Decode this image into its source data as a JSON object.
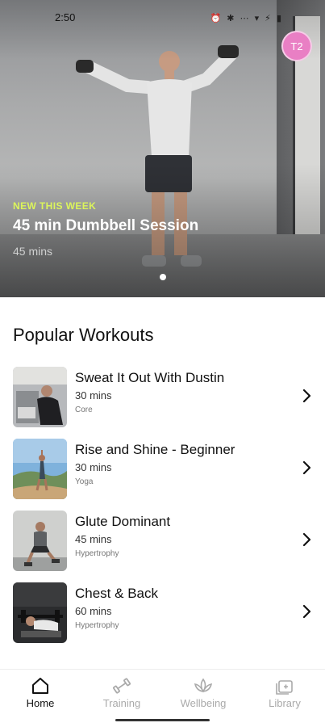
{
  "status_bar": {
    "time": "2:50",
    "icons": "⏰ ✱ ⋯ ▾ ⚡ ▮"
  },
  "profile": {
    "initials": "T2",
    "color": "#e97fc4"
  },
  "hero": {
    "tag": "NEW THIS WEEK",
    "title": "45 min Dumbbell Session",
    "subtitle": "45 mins",
    "tag_color": "#dcf55b",
    "carousel": {
      "count": 1,
      "active": 0
    }
  },
  "popular": {
    "title": "Popular Workouts",
    "items": [
      {
        "name": "Sweat It Out With Dustin",
        "duration": "30 mins",
        "category": "Core",
        "thumb": "gym-thumb"
      },
      {
        "name": "Rise and Shine - Beginner",
        "duration": "30 mins",
        "category": "Yoga",
        "thumb": "yoga-thumb"
      },
      {
        "name": "Glute Dominant",
        "duration": "45 mins",
        "category": "Hypertrophy",
        "thumb": "glute-thumb"
      },
      {
        "name": "Chest & Back",
        "duration": "60 mins",
        "category": "Hypertrophy",
        "thumb": "chest-thumb"
      }
    ]
  },
  "nav": {
    "items": [
      {
        "label": "Home",
        "icon": "home-icon",
        "active": true
      },
      {
        "label": "Training",
        "icon": "dumbbell-icon",
        "active": false
      },
      {
        "label": "Wellbeing",
        "icon": "lotus-icon",
        "active": false
      },
      {
        "label": "Library",
        "icon": "library-icon",
        "active": false
      }
    ]
  }
}
